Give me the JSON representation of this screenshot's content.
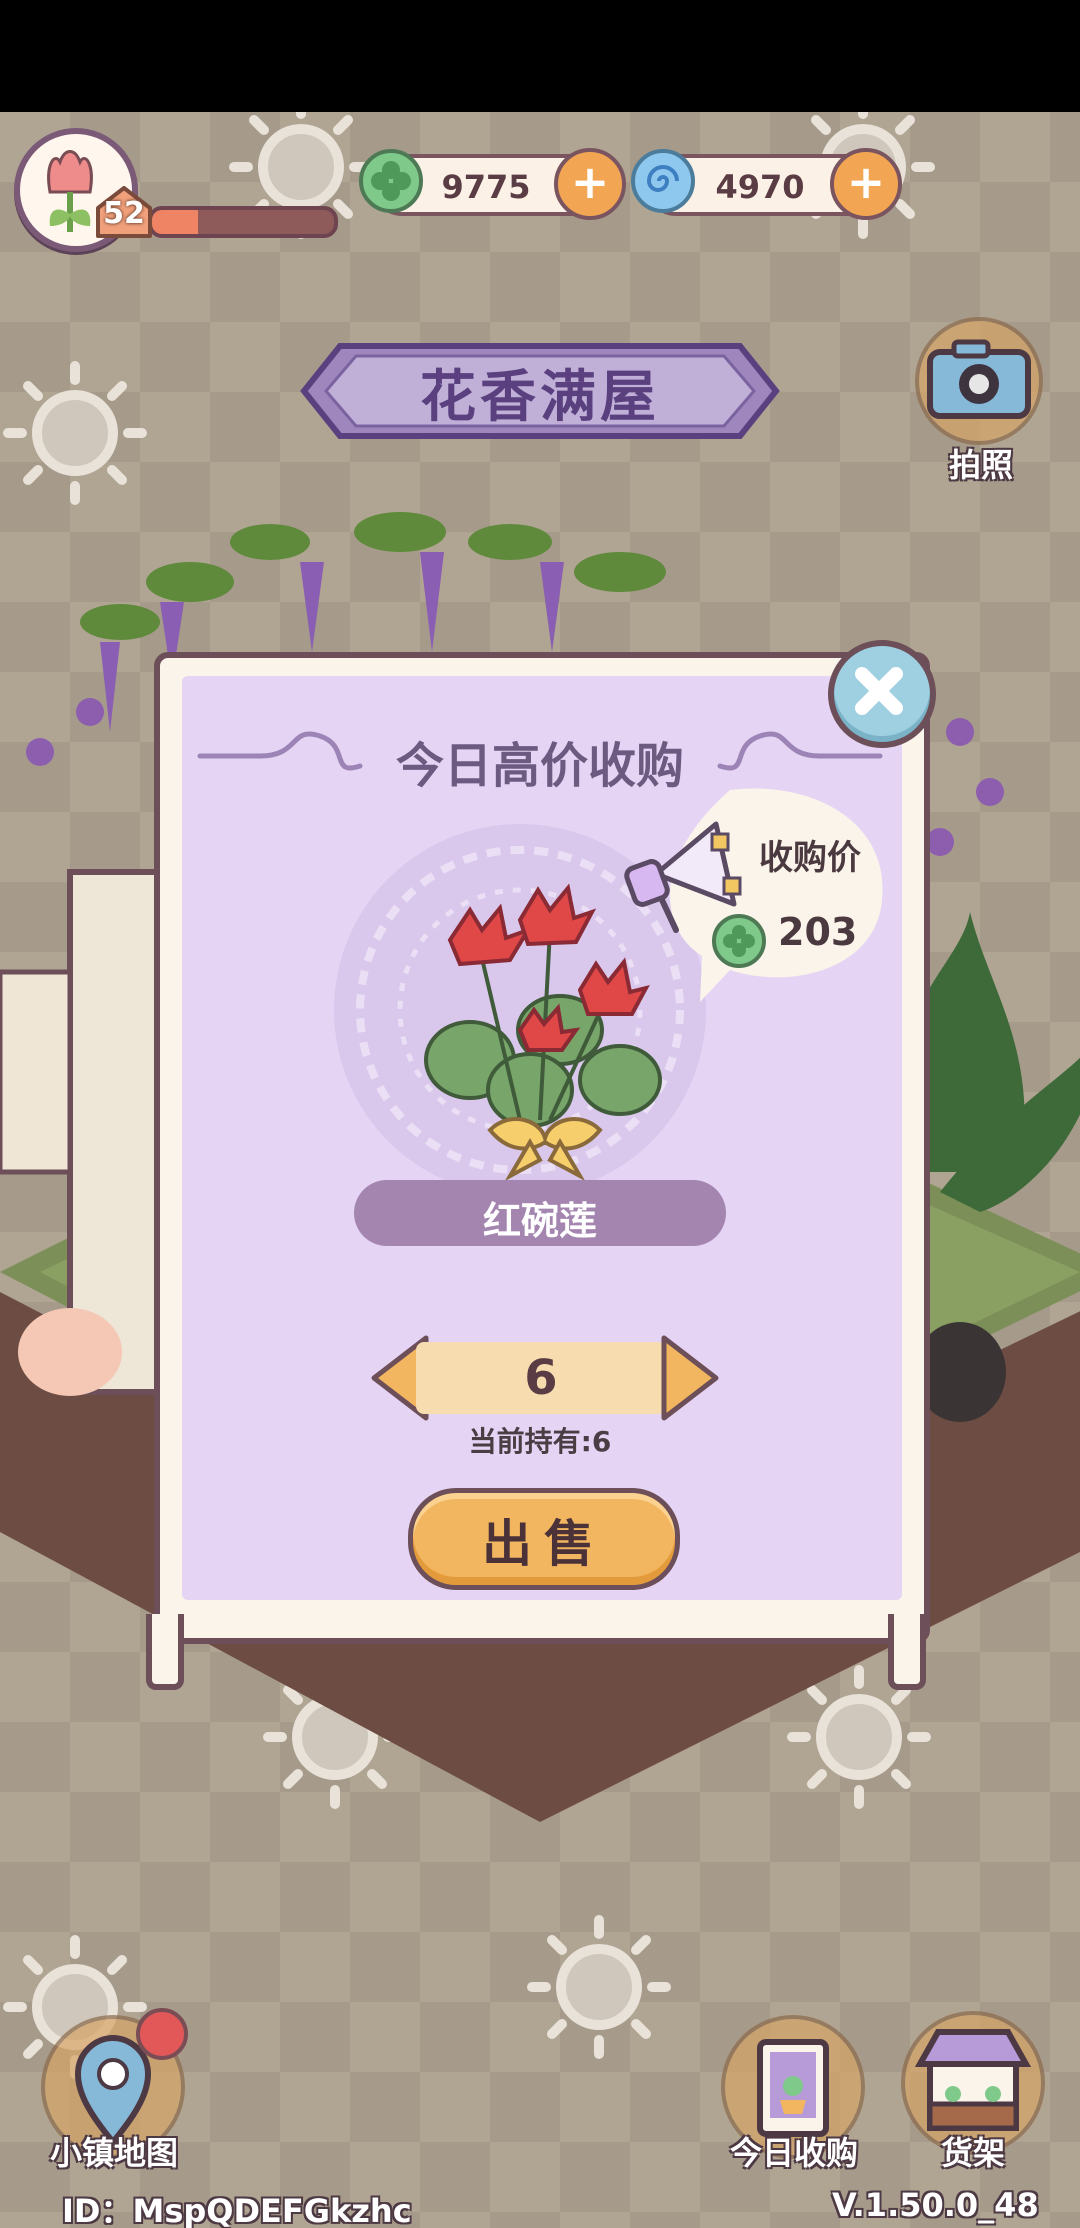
{
  "hud": {
    "level": "52",
    "xp_progress": 0.25,
    "clover_coins": "9775",
    "spiral_gems": "4970",
    "plus_label": "+"
  },
  "banner": {
    "title": "花香满屋"
  },
  "camera": {
    "label": "拍照",
    "icon": "camera-icon"
  },
  "popup": {
    "title": "今日高价收购",
    "price_label": "收购价",
    "price_value": "203",
    "flower_name": "红碗莲",
    "quantity": "6",
    "holding_text": "当前持有:6",
    "sell_label": "出售"
  },
  "bottom": {
    "map_label": "小镇地图",
    "today_label": "今日收购",
    "shelf_label": "货架"
  },
  "footer": {
    "id_text": "ID：MspQDEFGkzhc",
    "version_text": "V.1.50.0_48"
  },
  "colors": {
    "background": "#b0a493",
    "panel_purple": "#e5d4f4",
    "accent_orange": "#f3b660",
    "frame_brown": "#6c4f58"
  }
}
